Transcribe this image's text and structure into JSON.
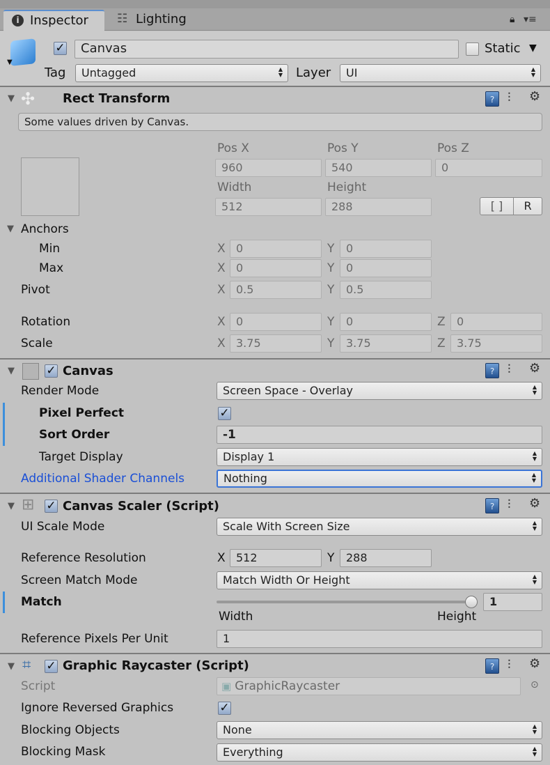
{
  "tabs": [
    {
      "label": "Inspector",
      "icon": "info-icon",
      "active": true
    },
    {
      "label": "Lighting",
      "icon": "sliders-icon",
      "active": false
    }
  ],
  "header": {
    "active": true,
    "name": "Canvas",
    "static_label": "Static",
    "static": false,
    "tag_label": "Tag",
    "tag": "Untagged",
    "layer_label": "Layer",
    "layer": "UI"
  },
  "rect_transform": {
    "title": "Rect Transform",
    "info": "Some values driven by Canvas.",
    "pos_x_label": "Pos X",
    "pos_y_label": "Pos Y",
    "pos_z_label": "Pos Z",
    "pos_x": "960",
    "pos_y": "540",
    "pos_z": "0",
    "width_label": "Width",
    "height_label": "Height",
    "width": "512",
    "height": "288",
    "blueprint_btn": "[ ]",
    "raw_btn": "R",
    "anchors_label": "Anchors",
    "min_label": "Min",
    "max_label": "Max",
    "min_x": "0",
    "min_y": "0",
    "max_x": "0",
    "max_y": "0",
    "pivot_label": "Pivot",
    "pivot_x": "0.5",
    "pivot_y": "0.5",
    "rotation_label": "Rotation",
    "rot_x": "0",
    "rot_y": "0",
    "rot_z": "0",
    "scale_label": "Scale",
    "scale_x": "3.75",
    "scale_y": "3.75",
    "scale_z": "3.75",
    "x": "X",
    "y": "Y",
    "z": "Z"
  },
  "canvas": {
    "title": "Canvas",
    "enabled": true,
    "render_mode_label": "Render Mode",
    "render_mode": "Screen Space - Overlay",
    "pixel_perfect_label": "Pixel Perfect",
    "pixel_perfect": true,
    "sort_order_label": "Sort Order",
    "sort_order": "-1",
    "target_display_label": "Target Display",
    "target_display": "Display 1",
    "shader_channels_label": "Additional Shader Channels",
    "shader_channels": "Nothing"
  },
  "canvas_scaler": {
    "title": "Canvas Scaler (Script)",
    "enabled": true,
    "ui_scale_mode_label": "UI Scale Mode",
    "ui_scale_mode": "Scale With Screen Size",
    "ref_res_label": "Reference Resolution",
    "ref_x": "512",
    "ref_y": "288",
    "match_mode_label": "Screen Match Mode",
    "match_mode": "Match Width Or Height",
    "match_label": "Match",
    "match": "1",
    "match_value": 1,
    "width_label": "Width",
    "height_label": "Height",
    "ppu_label": "Reference Pixels Per Unit",
    "ppu": "1"
  },
  "graphic_raycaster": {
    "title": "Graphic Raycaster (Script)",
    "enabled": true,
    "script_label": "Script",
    "script": "GraphicRaycaster",
    "ignore_reversed_label": "Ignore Reversed Graphics",
    "ignore_reversed": true,
    "blocking_objects_label": "Blocking Objects",
    "blocking_objects": "None",
    "blocking_mask_label": "Blocking Mask",
    "blocking_mask": "Everything"
  },
  "colors": {
    "accent": "#3c8fdc",
    "link_label": "#1a4fd6",
    "panel": "#c2c2c2"
  }
}
